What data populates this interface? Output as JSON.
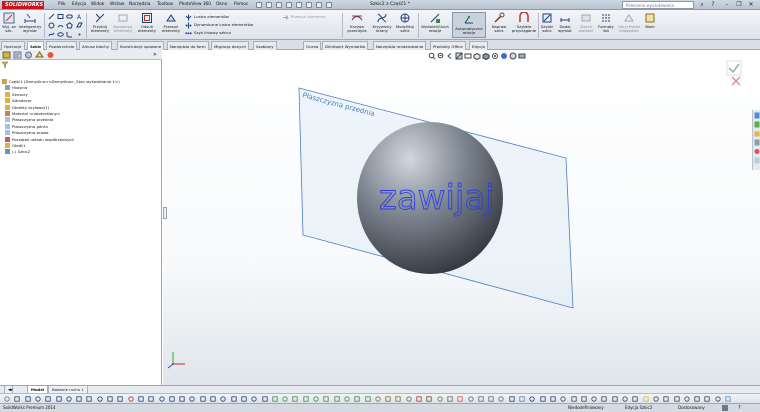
{
  "app": {
    "brand": "SOLIDWORKS",
    "window_title": "Szkic2 z Część1 *",
    "search_placeholder": "Polecenia wyszukiwania"
  },
  "menu": [
    "Plik",
    "Edycja",
    "Widok",
    "Wstaw",
    "Narzędzia",
    "Toolbox",
    "PhotoView 360",
    "Okno",
    "Pomoc"
  ],
  "ribbon": {
    "exit_sketch": "Wyj. ze szk.",
    "smart_dimension": "Inteligentny wymiar",
    "trim": "Przytnij elementy",
    "convert": "Konwertuj elementy",
    "offset": "Odsuń elementy",
    "extrude": "Przesuń elementy",
    "mirror": "Lustro elementów",
    "dynamic_mirror": "Dynamiczne lustro elementów",
    "linear_pattern": "Szyk liniowy szkicu",
    "move": "Przesuń elementy",
    "intersection": "Krzywa przecięcia",
    "face_curves": "Krzywizny ściany",
    "modify": "Modyfikuj szkic",
    "display_relations": "Wyświetl/Usuń relacje",
    "auto_relations": "Automatyczne relacje",
    "repair": "Napraw szkic",
    "quick_snaps": "Szybkie przyciąganie",
    "rapid": "Szybki szkic",
    "instant2d": "Dodaj wymiar",
    "shaded": "Zmień wartość",
    "format": "Formaty linii",
    "hide": "Ukryj Pokaż krawędzie",
    "blocks": "Bloki"
  },
  "tabs": [
    "Operacje",
    "Szkic",
    "Powierzchnie",
    "Arkusz blachy",
    "Konstrukcje spawane",
    "Narzędzia do form",
    "Migracja danych",
    "Szablony",
    "Ocena",
    "DimXpert Wymiarów",
    "Narzędzia renderowania",
    "Produkty Office",
    "Edycja"
  ],
  "active_tab": "Szkic",
  "tree": [
    {
      "label": "Część1  (Domyślna<<Domyślna>_Stan wyświetlania 1>)",
      "indent": 0,
      "icon": "part-icon",
      "color": "#caa24a"
    },
    {
      "label": "Historia",
      "indent": 1,
      "icon": "history-icon",
      "color": "#8ea1b6"
    },
    {
      "label": "Sensory",
      "indent": 1,
      "icon": "sensor-icon",
      "color": "#d5b445"
    },
    {
      "label": "Adnotacje",
      "indent": 1,
      "icon": "annotation-icon",
      "color": "#d5b445"
    },
    {
      "label": "Obiekty bryłowe(1)",
      "indent": 1,
      "icon": "solid-bodies-icon",
      "color": "#d5b445"
    },
    {
      "label": "Materiał <nieokreślony>",
      "indent": 1,
      "icon": "material-icon",
      "color": "#b9894e"
    },
    {
      "label": "Płaszczyzna przednia",
      "indent": 1,
      "icon": "plane-icon",
      "color": "#a9c0dc"
    },
    {
      "label": "Płaszczyzna górna",
      "indent": 1,
      "icon": "plane-icon",
      "color": "#a9c0dc"
    },
    {
      "label": "Płaszczyzna prawa",
      "indent": 1,
      "icon": "plane-icon",
      "color": "#a9c0dc"
    },
    {
      "label": "Początek układu współrzędnych",
      "indent": 1,
      "icon": "origin-icon",
      "color": "#c75a5a"
    },
    {
      "label": "Obrót1",
      "indent": 1,
      "icon": "revolve-icon",
      "color": "#d5b445"
    },
    {
      "label": "(-) Szkic2",
      "indent": 1,
      "icon": "sketch-icon",
      "color": "#6f8fbf"
    }
  ],
  "viewport": {
    "plane_label": "Płaszczyzna przednia",
    "sketch_text": "zawijaj",
    "sphere_color": "#7f8792",
    "text_color": "#2b3fe0",
    "plane_color": "#4a7fc0"
  },
  "bottom_tabs": [
    "Model",
    "Badanie ruchu 1"
  ],
  "active_bottom_tab": "Model",
  "status": {
    "product": "SolidWorks Premium 2014",
    "underdefined": "Niedodefiniowany",
    "editing": "Edycja Szkic2",
    "custom": "Dostosowany"
  }
}
